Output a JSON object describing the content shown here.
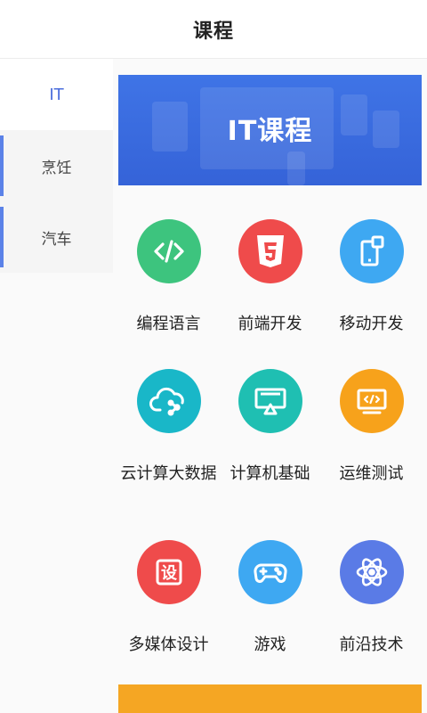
{
  "header": {
    "title": "课程"
  },
  "sidebar": {
    "items": [
      {
        "label": "IT"
      },
      {
        "label": "烹饪"
      },
      {
        "label": "汽车"
      }
    ]
  },
  "banner": {
    "text": "IT课程"
  },
  "grid": {
    "items": [
      {
        "label": "编程语言",
        "icon": "code-icon",
        "color": "#3dc47e"
      },
      {
        "label": "前端开发",
        "icon": "html5-icon",
        "color": "#ef4b4b"
      },
      {
        "label": "移动开发",
        "icon": "mobile-icon",
        "color": "#3ea8f2"
      },
      {
        "label": "云计算大数据",
        "icon": "cloud-icon",
        "color": "#19b7c8"
      },
      {
        "label": "计算机基础",
        "icon": "monitor-icon",
        "color": "#1fbfb2"
      },
      {
        "label": "运维测试",
        "icon": "terminal-icon",
        "color": "#f7a21b"
      },
      {
        "label": "多媒体设计",
        "icon": "design-icon",
        "color": "#ef4b4b"
      },
      {
        "label": "游戏",
        "icon": "gamepad-icon",
        "color": "#3ea8f2"
      },
      {
        "label": "前沿技术",
        "icon": "atom-icon",
        "color": "#5a7be6"
      }
    ]
  },
  "colors": {
    "accent": "#4a6cdc",
    "sidebar_bar": "#5b82e8"
  }
}
